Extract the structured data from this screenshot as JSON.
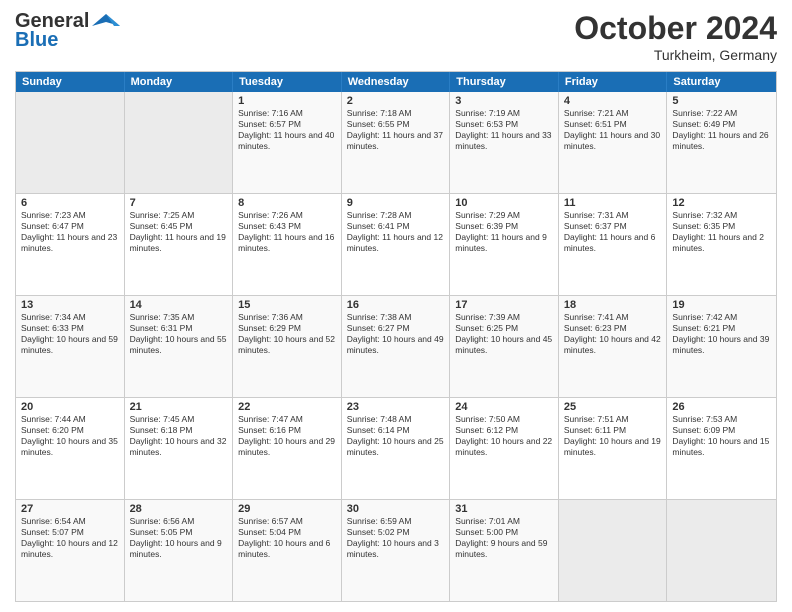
{
  "header": {
    "logo_line1": "General",
    "logo_line2": "Blue",
    "month": "October 2024",
    "location": "Turkheim, Germany"
  },
  "days_of_week": [
    "Sunday",
    "Monday",
    "Tuesday",
    "Wednesday",
    "Thursday",
    "Friday",
    "Saturday"
  ],
  "weeks": [
    [
      {
        "day": "",
        "empty": true
      },
      {
        "day": "",
        "empty": true
      },
      {
        "day": "1",
        "sunrise": "Sunrise: 7:16 AM",
        "sunset": "Sunset: 6:57 PM",
        "daylight": "Daylight: 11 hours and 40 minutes."
      },
      {
        "day": "2",
        "sunrise": "Sunrise: 7:18 AM",
        "sunset": "Sunset: 6:55 PM",
        "daylight": "Daylight: 11 hours and 37 minutes."
      },
      {
        "day": "3",
        "sunrise": "Sunrise: 7:19 AM",
        "sunset": "Sunset: 6:53 PM",
        "daylight": "Daylight: 11 hours and 33 minutes."
      },
      {
        "day": "4",
        "sunrise": "Sunrise: 7:21 AM",
        "sunset": "Sunset: 6:51 PM",
        "daylight": "Daylight: 11 hours and 30 minutes."
      },
      {
        "day": "5",
        "sunrise": "Sunrise: 7:22 AM",
        "sunset": "Sunset: 6:49 PM",
        "daylight": "Daylight: 11 hours and 26 minutes."
      }
    ],
    [
      {
        "day": "6",
        "sunrise": "Sunrise: 7:23 AM",
        "sunset": "Sunset: 6:47 PM",
        "daylight": "Daylight: 11 hours and 23 minutes."
      },
      {
        "day": "7",
        "sunrise": "Sunrise: 7:25 AM",
        "sunset": "Sunset: 6:45 PM",
        "daylight": "Daylight: 11 hours and 19 minutes."
      },
      {
        "day": "8",
        "sunrise": "Sunrise: 7:26 AM",
        "sunset": "Sunset: 6:43 PM",
        "daylight": "Daylight: 11 hours and 16 minutes."
      },
      {
        "day": "9",
        "sunrise": "Sunrise: 7:28 AM",
        "sunset": "Sunset: 6:41 PM",
        "daylight": "Daylight: 11 hours and 12 minutes."
      },
      {
        "day": "10",
        "sunrise": "Sunrise: 7:29 AM",
        "sunset": "Sunset: 6:39 PM",
        "daylight": "Daylight: 11 hours and 9 minutes."
      },
      {
        "day": "11",
        "sunrise": "Sunrise: 7:31 AM",
        "sunset": "Sunset: 6:37 PM",
        "daylight": "Daylight: 11 hours and 6 minutes."
      },
      {
        "day": "12",
        "sunrise": "Sunrise: 7:32 AM",
        "sunset": "Sunset: 6:35 PM",
        "daylight": "Daylight: 11 hours and 2 minutes."
      }
    ],
    [
      {
        "day": "13",
        "sunrise": "Sunrise: 7:34 AM",
        "sunset": "Sunset: 6:33 PM",
        "daylight": "Daylight: 10 hours and 59 minutes."
      },
      {
        "day": "14",
        "sunrise": "Sunrise: 7:35 AM",
        "sunset": "Sunset: 6:31 PM",
        "daylight": "Daylight: 10 hours and 55 minutes."
      },
      {
        "day": "15",
        "sunrise": "Sunrise: 7:36 AM",
        "sunset": "Sunset: 6:29 PM",
        "daylight": "Daylight: 10 hours and 52 minutes."
      },
      {
        "day": "16",
        "sunrise": "Sunrise: 7:38 AM",
        "sunset": "Sunset: 6:27 PM",
        "daylight": "Daylight: 10 hours and 49 minutes."
      },
      {
        "day": "17",
        "sunrise": "Sunrise: 7:39 AM",
        "sunset": "Sunset: 6:25 PM",
        "daylight": "Daylight: 10 hours and 45 minutes."
      },
      {
        "day": "18",
        "sunrise": "Sunrise: 7:41 AM",
        "sunset": "Sunset: 6:23 PM",
        "daylight": "Daylight: 10 hours and 42 minutes."
      },
      {
        "day": "19",
        "sunrise": "Sunrise: 7:42 AM",
        "sunset": "Sunset: 6:21 PM",
        "daylight": "Daylight: 10 hours and 39 minutes."
      }
    ],
    [
      {
        "day": "20",
        "sunrise": "Sunrise: 7:44 AM",
        "sunset": "Sunset: 6:20 PM",
        "daylight": "Daylight: 10 hours and 35 minutes."
      },
      {
        "day": "21",
        "sunrise": "Sunrise: 7:45 AM",
        "sunset": "Sunset: 6:18 PM",
        "daylight": "Daylight: 10 hours and 32 minutes."
      },
      {
        "day": "22",
        "sunrise": "Sunrise: 7:47 AM",
        "sunset": "Sunset: 6:16 PM",
        "daylight": "Daylight: 10 hours and 29 minutes."
      },
      {
        "day": "23",
        "sunrise": "Sunrise: 7:48 AM",
        "sunset": "Sunset: 6:14 PM",
        "daylight": "Daylight: 10 hours and 25 minutes."
      },
      {
        "day": "24",
        "sunrise": "Sunrise: 7:50 AM",
        "sunset": "Sunset: 6:12 PM",
        "daylight": "Daylight: 10 hours and 22 minutes."
      },
      {
        "day": "25",
        "sunrise": "Sunrise: 7:51 AM",
        "sunset": "Sunset: 6:11 PM",
        "daylight": "Daylight: 10 hours and 19 minutes."
      },
      {
        "day": "26",
        "sunrise": "Sunrise: 7:53 AM",
        "sunset": "Sunset: 6:09 PM",
        "daylight": "Daylight: 10 hours and 15 minutes."
      }
    ],
    [
      {
        "day": "27",
        "sunrise": "Sunrise: 6:54 AM",
        "sunset": "Sunset: 5:07 PM",
        "daylight": "Daylight: 10 hours and 12 minutes."
      },
      {
        "day": "28",
        "sunrise": "Sunrise: 6:56 AM",
        "sunset": "Sunset: 5:05 PM",
        "daylight": "Daylight: 10 hours and 9 minutes."
      },
      {
        "day": "29",
        "sunrise": "Sunrise: 6:57 AM",
        "sunset": "Sunset: 5:04 PM",
        "daylight": "Daylight: 10 hours and 6 minutes."
      },
      {
        "day": "30",
        "sunrise": "Sunrise: 6:59 AM",
        "sunset": "Sunset: 5:02 PM",
        "daylight": "Daylight: 10 hours and 3 minutes."
      },
      {
        "day": "31",
        "sunrise": "Sunrise: 7:01 AM",
        "sunset": "Sunset: 5:00 PM",
        "daylight": "Daylight: 9 hours and 59 minutes."
      },
      {
        "day": "",
        "empty": true
      },
      {
        "day": "",
        "empty": true
      }
    ]
  ]
}
